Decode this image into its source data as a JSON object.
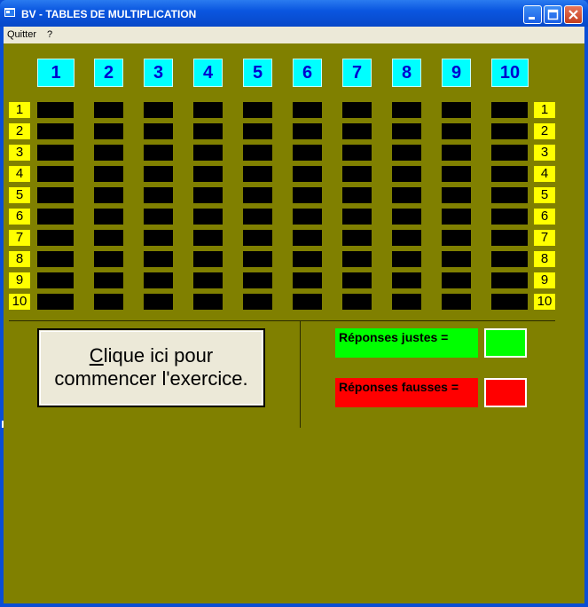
{
  "window": {
    "title": "BV - TABLES DE MULTIPLICATION"
  },
  "menu": {
    "items": [
      {
        "label": "Quitter"
      },
      {
        "label": "?"
      }
    ]
  },
  "grid": {
    "columns": [
      "1",
      "2",
      "3",
      "4",
      "5",
      "6",
      "7",
      "8",
      "9",
      "10"
    ],
    "rows": [
      "1",
      "2",
      "3",
      "4",
      "5",
      "6",
      "7",
      "8",
      "9",
      "10"
    ]
  },
  "start_button": {
    "line1_accel": "C",
    "line1_rest": "lique ici pour",
    "line2": "commencer l'exercice."
  },
  "score": {
    "correct_label": "Réponses justes =",
    "wrong_label": "Réponses fausses =",
    "correct_color": "#00ff00",
    "wrong_color": "#ff0000"
  },
  "colors": {
    "background": "#808000",
    "header_cell": "#00ffff",
    "row_label": "#ffff00",
    "answer_cell": "#000000"
  }
}
